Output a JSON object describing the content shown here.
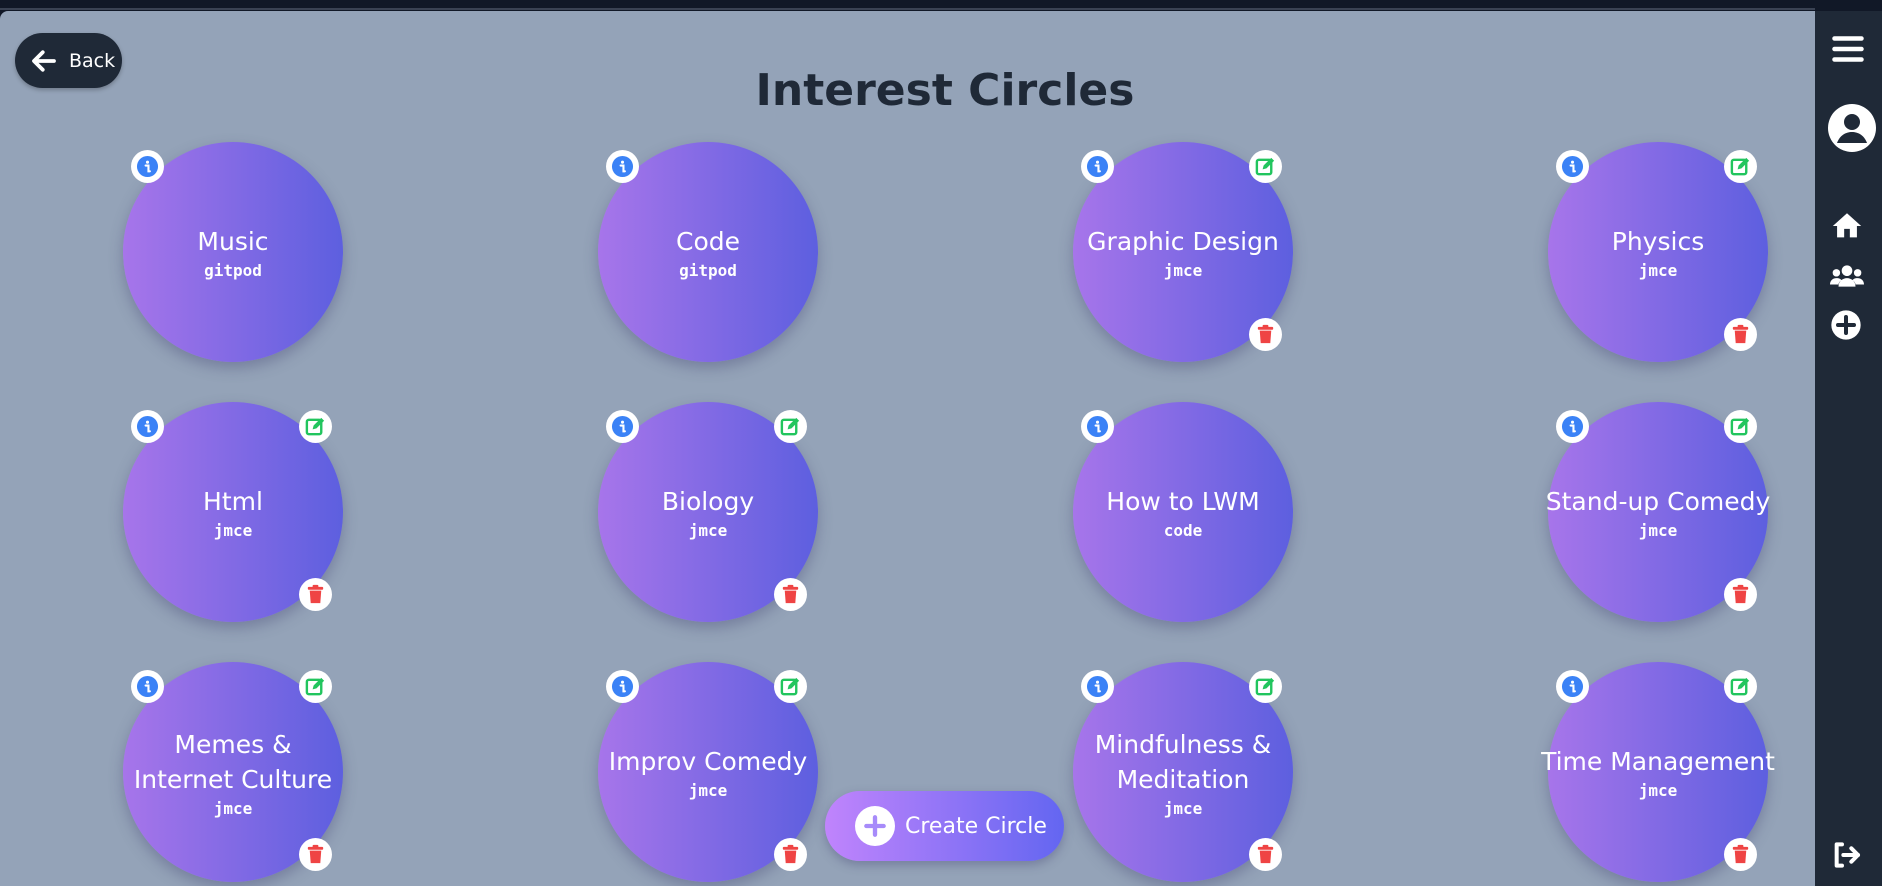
{
  "header": {
    "back_label": "Back",
    "title": "Interest Circles"
  },
  "circles": [
    {
      "name": "Music",
      "owner": "gitpod",
      "actions": [
        "info"
      ]
    },
    {
      "name": "Code",
      "owner": "gitpod",
      "actions": [
        "info"
      ]
    },
    {
      "name": "Graphic Design",
      "owner": "jmce",
      "actions": [
        "info",
        "edit",
        "delete"
      ]
    },
    {
      "name": "Physics",
      "owner": "jmce",
      "actions": [
        "info",
        "edit",
        "delete"
      ]
    },
    {
      "name": "Html",
      "owner": "jmce",
      "actions": [
        "info",
        "edit",
        "delete"
      ]
    },
    {
      "name": "Biology",
      "owner": "jmce",
      "actions": [
        "info",
        "edit",
        "delete"
      ]
    },
    {
      "name": "How to LWM",
      "owner": "code",
      "actions": [
        "info"
      ]
    },
    {
      "name": "Stand-up Comedy",
      "owner": "jmce",
      "actions": [
        "info",
        "edit",
        "delete"
      ]
    },
    {
      "name": "Memes & Internet Culture",
      "owner": "jmce",
      "actions": [
        "info",
        "edit",
        "delete"
      ]
    },
    {
      "name": "Improv Comedy",
      "owner": "jmce",
      "actions": [
        "info",
        "edit",
        "delete"
      ]
    },
    {
      "name": "Mindfulness & Meditation",
      "owner": "jmce",
      "actions": [
        "info",
        "edit",
        "delete"
      ]
    },
    {
      "name": "Time Management",
      "owner": "jmce",
      "actions": [
        "info",
        "edit",
        "delete"
      ]
    }
  ],
  "create_button": {
    "label": "Create Circle",
    "icon": "plus-circle-icon"
  },
  "sidebar": {
    "icons": [
      "menu-icon",
      "user-avatar-icon",
      "home-icon",
      "users-icon",
      "plus-circle-icon",
      "logout-icon"
    ]
  },
  "colors": {
    "background": "#94a3b8",
    "sidebar": "#1f2937",
    "circle_gradient_start": "#a775ea",
    "circle_gradient_end": "#5d5fdf",
    "info": "#3b82f6",
    "edit": "#22c55e",
    "delete": "#ef4444"
  }
}
